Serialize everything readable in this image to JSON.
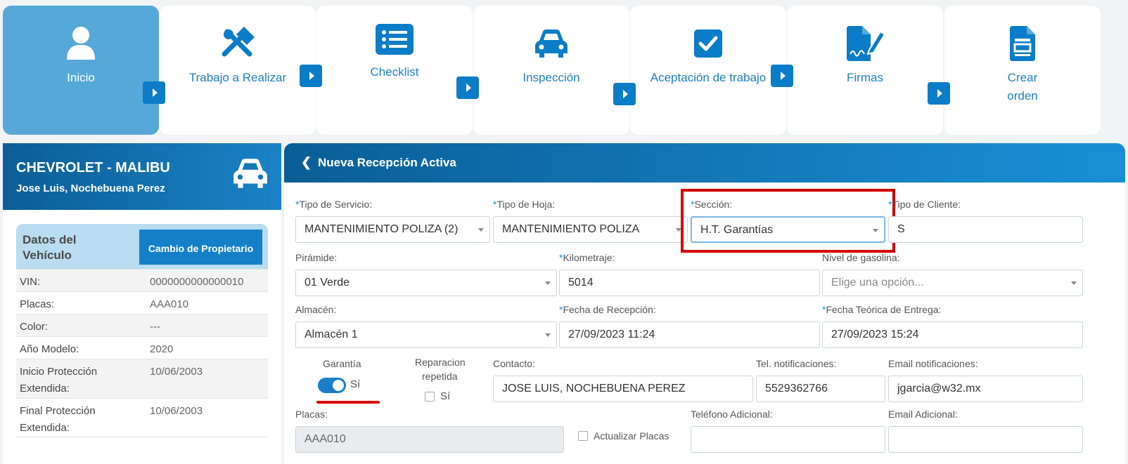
{
  "steps": [
    {
      "label": "Inicio",
      "icon": "user-icon"
    },
    {
      "label": "Trabajo a Realizar",
      "icon": "tools-icon"
    },
    {
      "label": "Checklist",
      "icon": "list-icon"
    },
    {
      "label": "Inspección",
      "icon": "car-icon"
    },
    {
      "label": "Aceptación de trabajo",
      "icon": "check-square-icon"
    },
    {
      "label": "Firmas",
      "icon": "signature-icon"
    },
    {
      "label_line1": "Crear",
      "label_line2": "orden",
      "icon": "file-icon"
    }
  ],
  "vehicle": {
    "title": "CHEVROLET - MALIBU",
    "owner": "Jose Luis, Nochebuena Perez",
    "section_title": "Datos del Vehículo",
    "change_owner_button": "Cambio de Propietario",
    "rows": [
      {
        "label": "VIN:",
        "value": "0000000000000010"
      },
      {
        "label": "Placas:",
        "value": "AAA010"
      },
      {
        "label": "Color:",
        "value": "---"
      },
      {
        "label": "Año Modelo:",
        "value": "2020"
      },
      {
        "label": "Inicio Protección Extendida:",
        "value": "10/06/2003"
      },
      {
        "label": "Final Protección Extendida:",
        "value": "10/06/2003"
      }
    ]
  },
  "form": {
    "header": "Nueva Recepción Activa",
    "tipo_servicio": {
      "label": "Tipo de Servicio:",
      "value": "MANTENIMIENTO POLIZA (2)"
    },
    "tipo_hoja": {
      "label": "Tipo de Hoja:",
      "value": "MANTENIMIENTO POLIZA"
    },
    "seccion": {
      "label": "Sección:",
      "value": "H.T. Garantías"
    },
    "tipo_cliente": {
      "label": "Tipo de Cliente:",
      "value": "S"
    },
    "piramide": {
      "label": "Pirámide:",
      "value": "01 Verde"
    },
    "kilometraje": {
      "label": "Kilometraje:",
      "value": "5014"
    },
    "nivel_gasolina": {
      "label": "Nivel de gasolina:",
      "placeholder": "Elige una opción..."
    },
    "almacen": {
      "label": "Almacén:",
      "value": "Almacén 1"
    },
    "fecha_recepcion": {
      "label": "Fecha de Recepción:",
      "value": "27/09/2023 11:24"
    },
    "fecha_entrega": {
      "label": "Fecha Teórica de Entrega:",
      "value": "27/09/2023 15:24"
    },
    "garantia": {
      "label": "Garantía",
      "toggle_label": "Sí",
      "checked": true
    },
    "reparacion": {
      "label_line1": "Reparacion",
      "label_line2": "repetida",
      "check_label": "Sí",
      "checked": false
    },
    "contacto": {
      "label": "Contacto:",
      "value": "JOSE LUIS, NOCHEBUENA PEREZ"
    },
    "tel_notif": {
      "label": "Tel. notificaciones:",
      "value": "5529362766"
    },
    "email_notif": {
      "label": "Email notificaciones:",
      "value": "jgarcia@w32.mx"
    },
    "placas": {
      "label": "Placas:",
      "value": "AAA010"
    },
    "actualizar_placas": {
      "label": "Actualizar Placas",
      "checked": false
    },
    "tel_adicional": {
      "label": "Teléfono Adicional:",
      "value": ""
    },
    "email_adicional": {
      "label": "Email Adicional:",
      "value": ""
    }
  },
  "colors": {
    "accent": "#1380c8",
    "active_step": "#56a8d8",
    "highlight": "#d40000"
  }
}
